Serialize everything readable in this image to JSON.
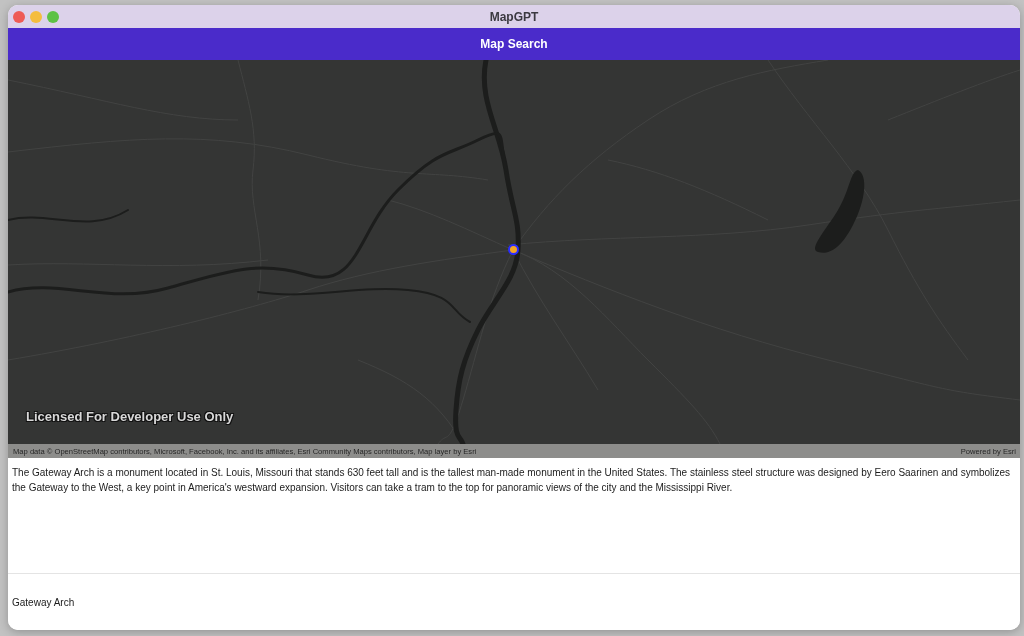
{
  "window": {
    "title": "MapGPT"
  },
  "header": {
    "title": "Map Search"
  },
  "map": {
    "overlay_text": "Licensed For Developer Use Only",
    "attribution": "Map data © OpenStreetMap contributors, Microsoft, Facebook, Inc. and its affiliates, Esri Community Maps contributors, Map layer by Esri",
    "powered_by": "Powered by Esri"
  },
  "description": "The Gateway Arch is a monument located in St. Louis, Missouri that stands 630 feet tall and is the tallest man-made monument in the United States. The stainless steel structure was designed by Eero Saarinen and symbolizes the Gateway to the West, a key point in America's westward expansion. Visitors can take a tram to the top for panoramic views of the city and the Mississippi River.",
  "search": {
    "value": "Gateway Arch"
  }
}
